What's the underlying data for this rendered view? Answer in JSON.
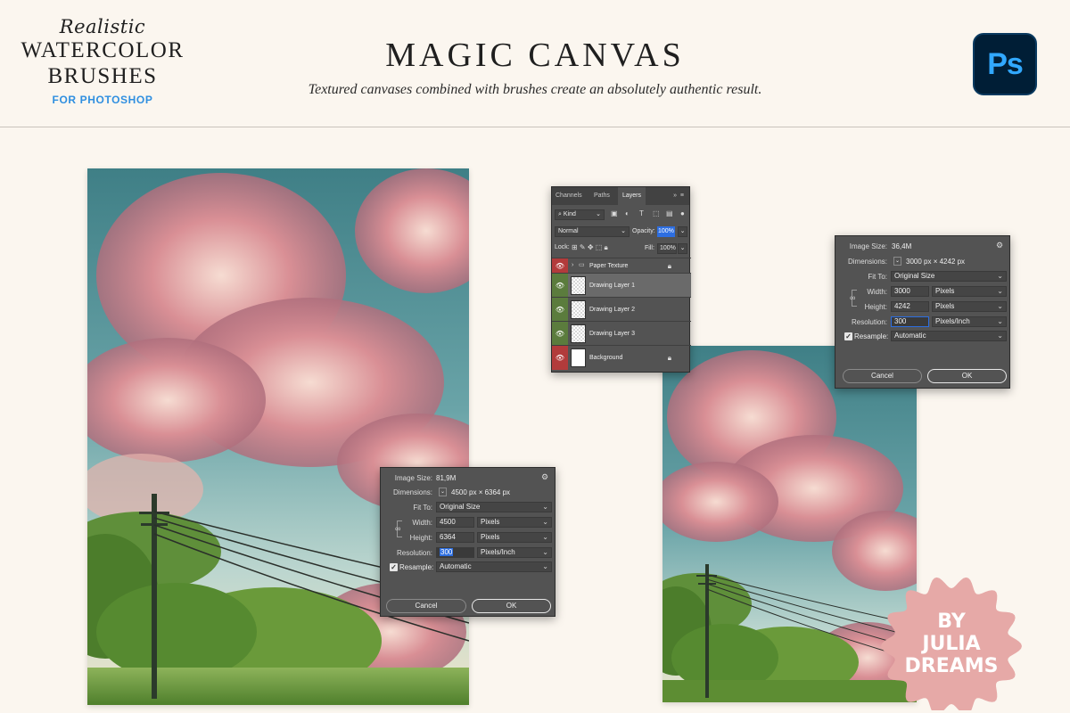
{
  "brand": {
    "line1": "Realistic",
    "line2": "WATERCOLOR",
    "line3": "BRUSHES",
    "line4": "FOR PHOTOSHOP"
  },
  "header": {
    "title": "MAGIC CANVAS",
    "subtitle": "Textured canvases combined with brushes create an absolutely authentic result."
  },
  "logo": {
    "text": "Ps",
    "bg": "#001e36",
    "fg": "#31a8ff"
  },
  "dialog_large": {
    "image_size_label": "Image Size:",
    "image_size_value": "81,9M",
    "dimensions_label": "Dimensions:",
    "dimensions_value": "4500 px  ×  6364 px",
    "fit_to_label": "Fit To:",
    "fit_to_value": "Original Size",
    "width_label": "Width:",
    "width_value": "4500",
    "width_unit": "Pixels",
    "height_label": "Height:",
    "height_value": "6364",
    "height_unit": "Pixels",
    "resolution_label": "Resolution:",
    "resolution_value": "300",
    "resolution_unit": "Pixels/Inch",
    "resample_label": "Resample:",
    "resample_value": "Automatic",
    "cancel": "Cancel",
    "ok": "OK"
  },
  "dialog_small": {
    "image_size_label": "Image Size:",
    "image_size_value": "36,4M",
    "dimensions_label": "Dimensions:",
    "dimensions_value": "3000 px  ×  4242 px",
    "fit_to_label": "Fit To:",
    "fit_to_value": "Original Size",
    "width_label": "Width:",
    "width_value": "3000",
    "width_unit": "Pixels",
    "height_label": "Height:",
    "height_value": "4242",
    "height_unit": "Pixels",
    "resolution_label": "Resolution:",
    "resolution_value": "300",
    "resolution_unit": "Pixels/Inch",
    "resample_label": "Resample:",
    "resample_value": "Automatic",
    "cancel": "Cancel",
    "ok": "OK"
  },
  "layers_panel": {
    "tabs": [
      "Channels",
      "Paths",
      "Layers"
    ],
    "kind": "Kind",
    "blend_mode": "Normal",
    "opacity_label": "Opacity:",
    "opacity_value": "100%",
    "lock_label": "Lock:",
    "fill_label": "Fill:",
    "fill_value": "100%",
    "layers": [
      {
        "name": "Paper Texture",
        "eye_color": "#b23b3b"
      },
      {
        "name": "Drawing Layer 1",
        "eye_color": "#5b7c3d"
      },
      {
        "name": "Drawing Layer 2",
        "eye_color": "#5b7c3d"
      },
      {
        "name": "Drawing Layer 3",
        "eye_color": "#5b7c3d"
      },
      {
        "name": "Background",
        "eye_color": "#b23b3b"
      }
    ]
  },
  "badge": {
    "line1": "BY",
    "line2": "JULIA",
    "line3": "DREAMS",
    "color": "#e6a9a7"
  }
}
